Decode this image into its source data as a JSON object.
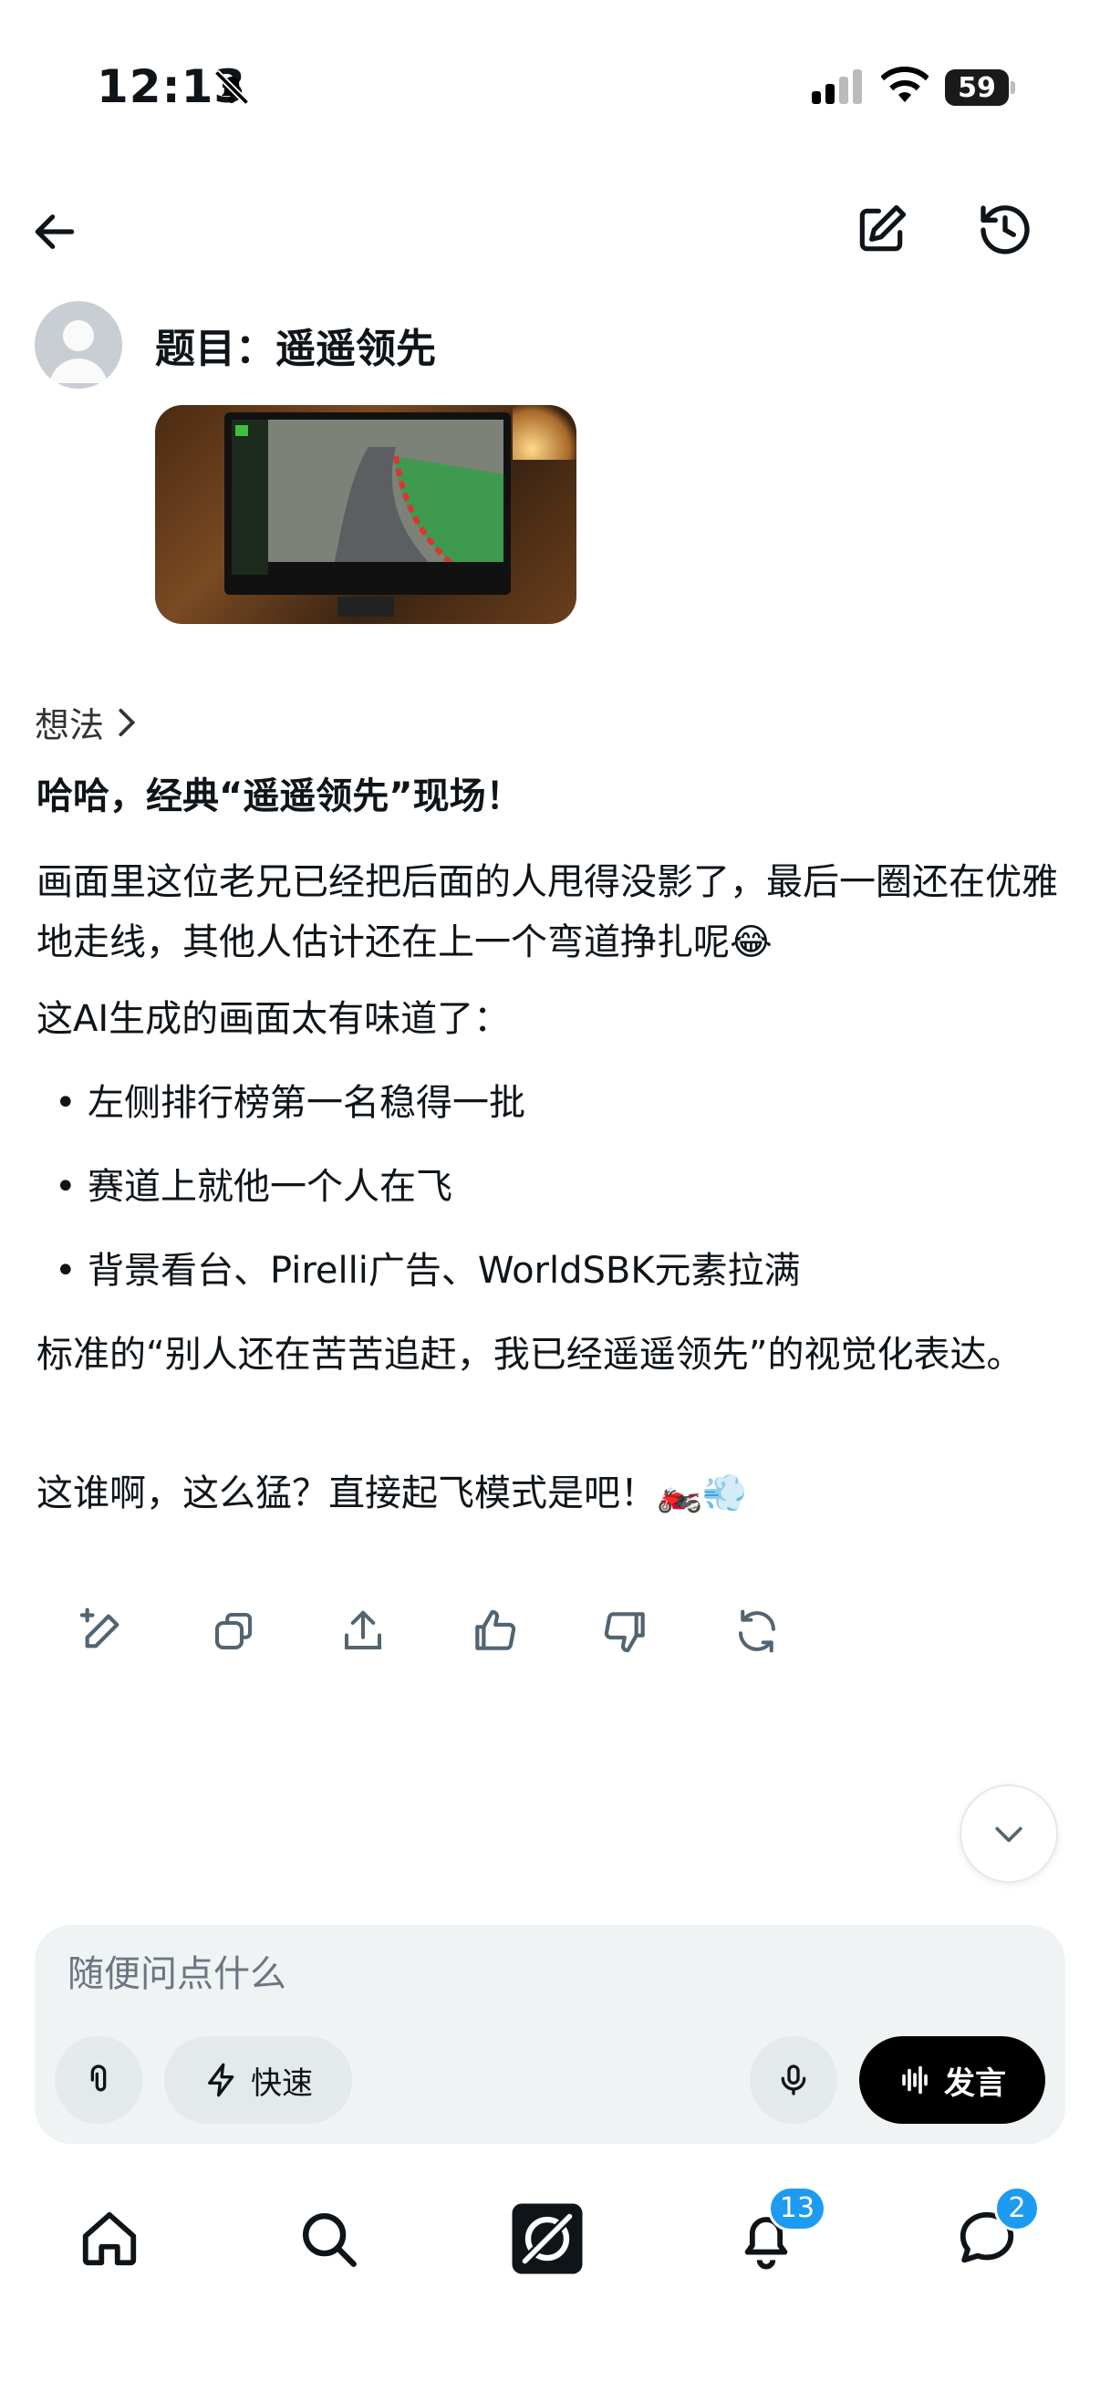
{
  "status_bar": {
    "time": "12:13",
    "battery": "59"
  },
  "prompt": {
    "title": "题目：遥遥领先"
  },
  "response": {
    "thoughts_label": "想法",
    "headline": "哈哈，经典“遥遥领先”现场！",
    "para1": "画面里这位老兄已经把后面的人甩得没影了，最后一圈还在优雅地走线，其他人估计还在上一个弯道挣扎呢😂",
    "para2": "这AI生成的画面太有味道了：",
    "bullets": [
      "左侧排行榜第一名稳得一批",
      "赛道上就他一个人在飞",
      "背景看台、Pirelli广告、WorldSBK元素拉满"
    ],
    "para3": "标准的“别人还在苦苦追赶，我已经遥遥领先”的视觉化表达。",
    "para4": "这谁啊，这么猛？直接起飞模式是吧！🏍️💨"
  },
  "composer": {
    "placeholder": "随便问点什么",
    "quick_label": "快速",
    "speak_label": "发言"
  },
  "nav": {
    "notifications_badge": "13",
    "messages_badge": "2"
  },
  "icons": {
    "back": "arrow-left-icon",
    "edit": "edit-icon",
    "history": "history-icon",
    "actions": [
      "edit-pen-icon",
      "copy-icon",
      "share-icon",
      "thumbs-up-icon",
      "thumbs-down-icon",
      "regenerate-icon"
    ],
    "tabs": [
      "home-icon",
      "search-icon",
      "grok-icon",
      "bell-icon",
      "chat-icon"
    ]
  },
  "colors": {
    "accent": "#1d9bf0",
    "text": "#0f1419",
    "composer_bg": "#eff3f4"
  }
}
